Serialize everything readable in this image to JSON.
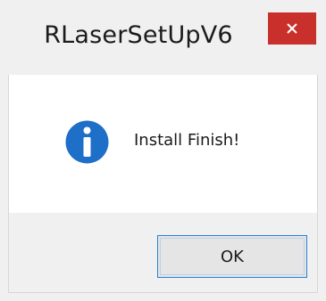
{
  "window": {
    "title": "RLaserSetUpV6",
    "close_icon": "close-icon",
    "accent_close_color": "#c9302c"
  },
  "dialog": {
    "icon": "info-icon",
    "icon_color": "#1e6fc8",
    "message": "Install Finish!",
    "ok_label": "OK"
  }
}
